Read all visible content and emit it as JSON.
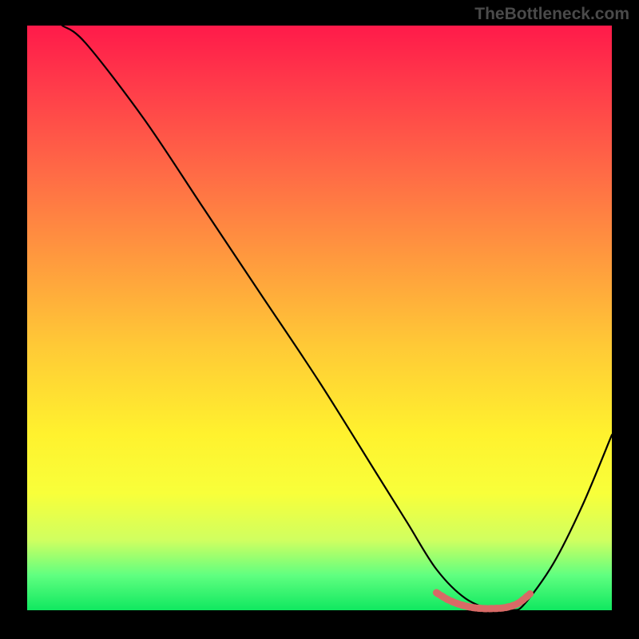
{
  "watermark": "TheBottleneck.com",
  "chart_data": {
    "type": "line",
    "title": "",
    "xlabel": "",
    "ylabel": "",
    "xlim": [
      0,
      100
    ],
    "ylim": [
      0,
      100
    ],
    "series": [
      {
        "name": "bottleneck-curve",
        "color": "#000000",
        "x": [
          6,
          10,
          20,
          30,
          40,
          50,
          60,
          65,
          70,
          75,
          80,
          83,
          85,
          90,
          95,
          100
        ],
        "values": [
          100,
          97,
          84,
          69,
          54,
          39,
          23,
          15,
          7,
          2,
          0,
          0,
          1,
          8,
          18,
          30
        ]
      },
      {
        "name": "optimal-band",
        "color": "#d86a66",
        "x": [
          70,
          72,
          74,
          76,
          78,
          80,
          82,
          84,
          86
        ],
        "values": [
          3,
          1.8,
          1.0,
          0.5,
          0.3,
          0.3,
          0.5,
          1.2,
          2.8
        ]
      }
    ],
    "gradient_stops": [
      {
        "pos": 0,
        "meaning": "worst",
        "color": "#ff1a4a"
      },
      {
        "pos": 50,
        "meaning": "mid",
        "color": "#ffca36"
      },
      {
        "pos": 100,
        "meaning": "best",
        "color": "#10e860"
      }
    ]
  }
}
